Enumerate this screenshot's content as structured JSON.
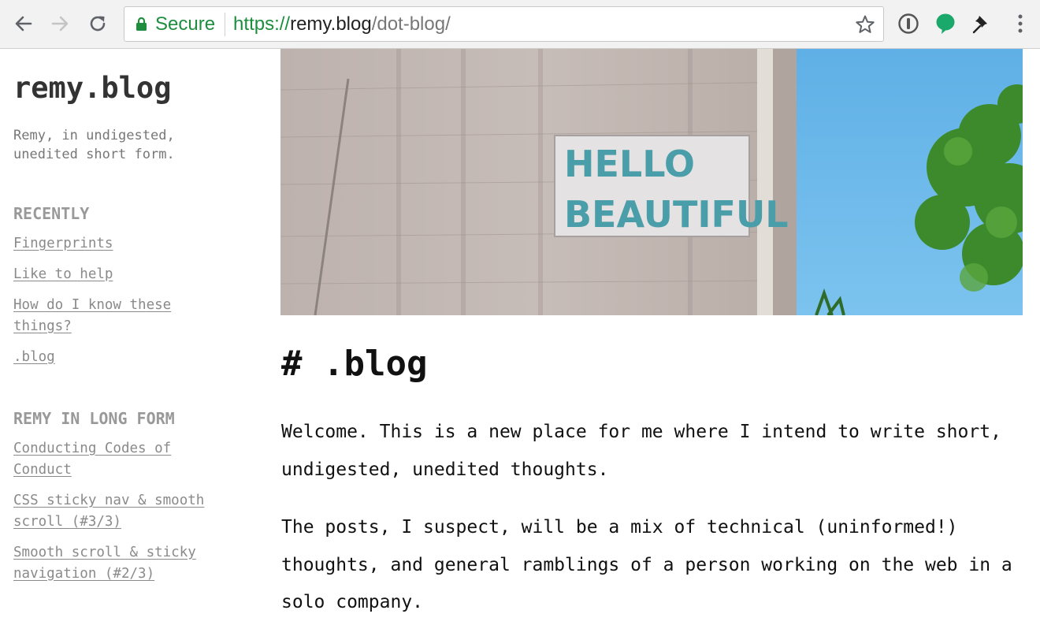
{
  "browser": {
    "secure_label": "Secure",
    "url_scheme": "https://",
    "url_host": "remy.blog",
    "url_path": "/dot-blog/",
    "icons": [
      "back-arrow-icon",
      "forward-arrow-icon",
      "reload-icon",
      "lock-icon",
      "bookmark-star-icon",
      "onepassword-extension-icon",
      "speech-bubble-extension-icon",
      "pin-extension-icon",
      "menu-kebab-icon"
    ],
    "colors": {
      "secure_green": "#1e8e3e",
      "chrome_bg": "#f2f2f2"
    }
  },
  "sidebar": {
    "title": "remy.blog",
    "tagline": "Remy, in undigested, unedited short form.",
    "recently": {
      "heading": "RECENTLY",
      "items": [
        {
          "label": "Fingerprints"
        },
        {
          "label": "Like to help"
        },
        {
          "label": "How do I know these things?"
        },
        {
          "label": ".blog"
        }
      ]
    },
    "long_form": {
      "heading": "REMY IN LONG FORM",
      "items": [
        {
          "label": "Conducting Codes of Conduct"
        },
        {
          "label": "CSS sticky nav & smooth scroll (#3/3)"
        },
        {
          "label": "Smooth scroll & sticky navigation (#2/3)"
        }
      ]
    }
  },
  "main": {
    "hero_sign": {
      "line1": "HELLO",
      "line2": "BEAUTIFUL"
    },
    "heading": "# .blog",
    "paragraphs": [
      "Welcome. This is a new place for me where I intend to write short, undigested, unedited thoughts.",
      "The posts, I suspect, will be a mix of technical (uninformed!) thoughts, and general ramblings of a person working on the web in a solo company."
    ]
  }
}
